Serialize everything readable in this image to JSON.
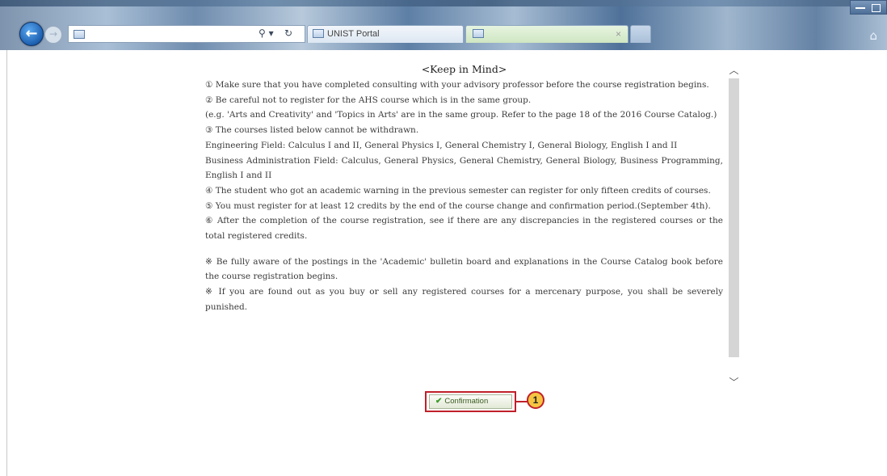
{
  "browser": {
    "back_icon": "back-arrow-icon",
    "forward_icon": "forward-arrow-icon",
    "address_icon": "page-icon",
    "search_icon": "search-icon",
    "search_glyph": "⚲ ▾",
    "refresh_glyph": "↻",
    "tabs": [
      {
        "label": "UNIST Portal",
        "icon": "page-icon"
      },
      {
        "label": "",
        "icon": "page-icon",
        "close": "×"
      }
    ],
    "home_icon": "home-icon",
    "home_glyph": "⌂"
  },
  "notice": {
    "title": "<Keep in Mind>",
    "paragraphs": [
      "① Make sure that you have completed consulting with your advisory professor before the course registration begins.",
      "② Be careful not to register for the AHS course which is in the same group.",
      "(e.g. 'Arts and Creativity' and 'Topics in Arts' are in the same group. Refer to the page 18 of the 2016 Course Catalog.)",
      "③ The courses listed below cannot be withdrawn.",
      "Engineering Field: Calculus I and II, General Physics I, General Chemistry I, General Biology, English I and II",
      "Business Administration Field: Calculus, General Physics, General Chemistry, General Biology, Business Programming, English I and II",
      "④ The student who got an academic warning in the previous semester can register for only fifteen credits of courses.",
      "⑤ You must register for at least 12 credits by the end of the course change and confirmation period.(September 4th).",
      "⑥ After the completion of the course registration, see if there are any discrepancies in the registered courses or the total registered credits.",
      "※ Be fully aware of the postings in the 'Academic' bulletin board and explanations in the Course Catalog book before the course registration begins.",
      "※ If you are found out as you buy or sell any registered courses for a mercenary purpose, you shall be severely punished."
    ]
  },
  "scrollbar": {
    "up_glyph": "︿",
    "down_glyph": "﹀"
  },
  "confirm": {
    "label": "Confirmation",
    "icon": "check-icon",
    "check_glyph": "✔",
    "callout_number": "1",
    "highlight_color": "#c0202a"
  }
}
